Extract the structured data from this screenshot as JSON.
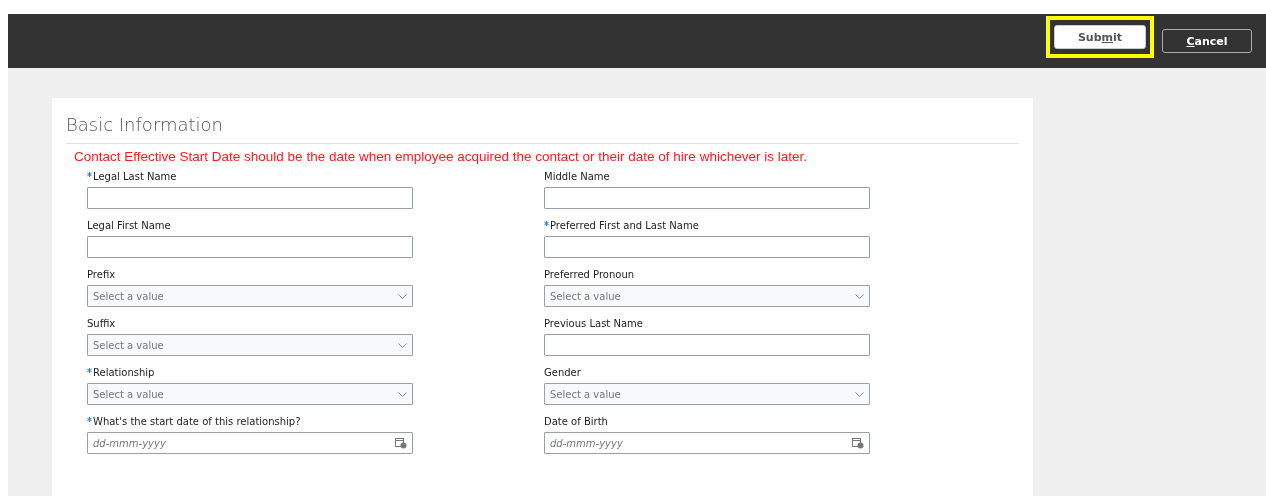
{
  "header": {
    "buttons": [
      {
        "label_before": "Sub",
        "access_key": "m",
        "label_after": "it",
        "kind": "primary",
        "highlighted": true
      },
      {
        "access_key": "C",
        "label_after": "ancel",
        "kind": "secondary",
        "highlighted": false
      }
    ]
  },
  "section": {
    "title": "Basic Information",
    "notice": "Contact Effective Start Date should be the date when employee acquired the contact or their date of hire whichever is later.",
    "fields": [
      {
        "label": "Legal Last Name",
        "required": true,
        "kind": "text"
      },
      {
        "label": "Middle Name",
        "required": false,
        "kind": "text"
      },
      {
        "label": "Legal First Name",
        "required": false,
        "kind": "text"
      },
      {
        "label": "Preferred First and Last Name",
        "required": true,
        "kind": "text"
      },
      {
        "label": "Prefix",
        "required": false,
        "kind": "select",
        "placeholder": "Select a value"
      },
      {
        "label": "Preferred Pronoun",
        "required": false,
        "kind": "select",
        "placeholder": "Select a value"
      },
      {
        "label": "Suffix",
        "required": false,
        "kind": "select",
        "placeholder": "Select a value"
      },
      {
        "label": "Previous Last Name",
        "required": false,
        "kind": "text"
      },
      {
        "label": "Relationship",
        "required": true,
        "kind": "select",
        "placeholder": "Select a value"
      },
      {
        "label": "Gender",
        "required": false,
        "kind": "select",
        "placeholder": "Select a value"
      },
      {
        "label": "What's the start date of this relationship?",
        "required": true,
        "kind": "date",
        "placeholder": "dd-mmm-yyyy"
      },
      {
        "label": "Date of Birth",
        "required": false,
        "kind": "date",
        "placeholder": "dd-mmm-yyyy"
      }
    ]
  }
}
